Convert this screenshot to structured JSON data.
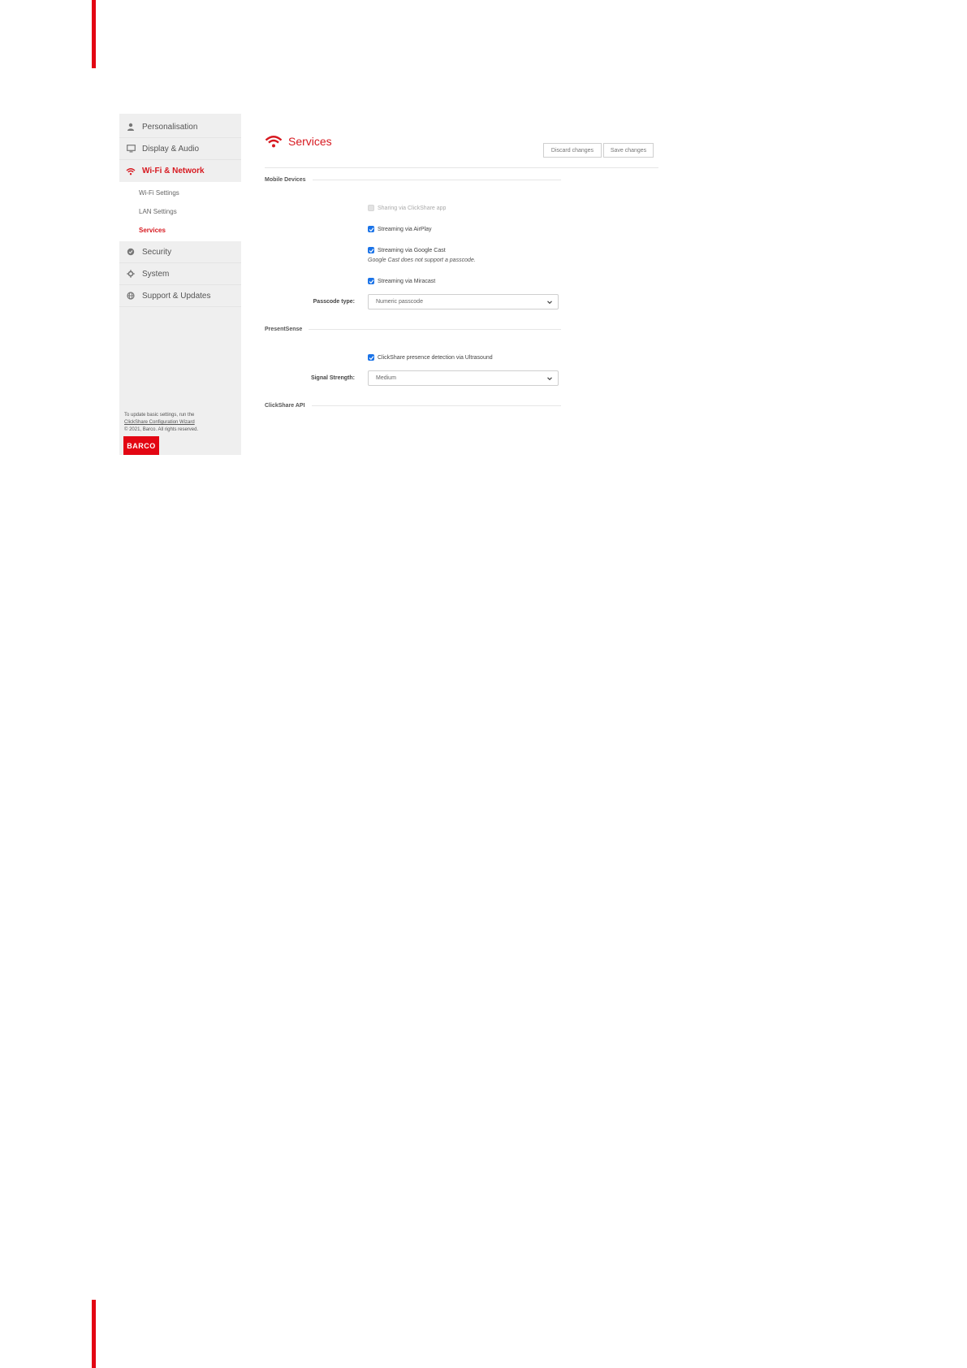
{
  "sidebar": {
    "items": [
      {
        "label": "Personalisation",
        "icon": "person-icon"
      },
      {
        "label": "Display & Audio",
        "icon": "monitor-icon"
      },
      {
        "label": "Wi-Fi & Network",
        "icon": "wifi-icon"
      },
      {
        "label": "Security",
        "icon": "shield-icon"
      },
      {
        "label": "System",
        "icon": "gear-icon"
      },
      {
        "label": "Support & Updates",
        "icon": "globe-icon"
      }
    ],
    "subitems": [
      "Wi-Fi Settings",
      "LAN Settings",
      "Services"
    ],
    "footer": {
      "line1": "To update basic settings, run the",
      "link": "ClickShare Configuration Wizard",
      "copyright": "© 2021, Barco. All rights reserved."
    },
    "logo": "BARCO"
  },
  "main": {
    "title": "Services",
    "discard_label": "Discard changes",
    "save_label": "Save changes",
    "sections": {
      "mobile": "Mobile Devices",
      "presentsense": "PresentSense",
      "api": "ClickShare API"
    },
    "options": {
      "clickshare_app": {
        "label": "Sharing via ClickShare app",
        "checked": false
      },
      "airplay": {
        "label": "Streaming via AirPlay",
        "checked": true
      },
      "googlecast": {
        "label": "Streaming via Google Cast",
        "checked": true
      },
      "googlecast_note": "Google Cast does not support a passcode.",
      "miracast": {
        "label": "Streaming via Miracast",
        "checked": true
      },
      "ultrasound": {
        "label": "ClickShare presence detection via Ultrasound",
        "checked": true
      }
    },
    "passcode": {
      "label": "Passcode type:",
      "value": "Numeric passcode"
    },
    "signal": {
      "label": "Signal Strength:",
      "value": "Medium"
    }
  },
  "colors": {
    "accent": "#d71920",
    "brand": "#e30613",
    "checkbox": "#1a73e8"
  }
}
